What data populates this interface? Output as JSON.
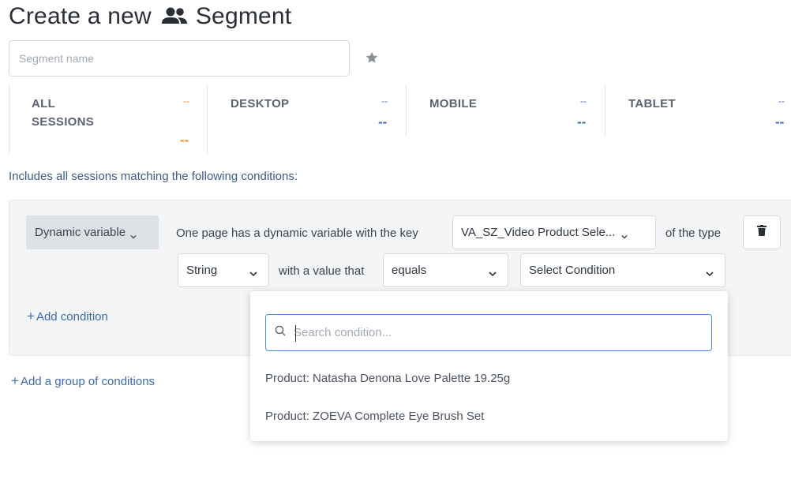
{
  "header": {
    "title_part1": "Create a new",
    "title_part2": "Segment",
    "icon": "people-icon"
  },
  "segment_name": {
    "placeholder": "Segment name",
    "value": ""
  },
  "stats": [
    {
      "label": "ALL",
      "label2": "SESSIONS",
      "small": "--",
      "big": "--",
      "color": "#f08a24"
    },
    {
      "label": "DESKTOP",
      "label2": "",
      "small": "--",
      "big": "--",
      "color": "#3c6aa8"
    },
    {
      "label": "MOBILE",
      "label2": "",
      "small": "--",
      "big": "--",
      "color": "#3c6aa8"
    },
    {
      "label": "TABLET",
      "label2": "",
      "small": "--",
      "big": "--",
      "color": "#3c6aa8"
    }
  ],
  "includes_text": "Includes all sessions matching the following conditions:",
  "condition": {
    "type_button": "Dynamic variable",
    "text1": "One page has a dynamic variable with the key",
    "key_select": "VA_SZ_Video Product Sele...",
    "text2": "of the type",
    "data_type": "String",
    "text3": "with a value that",
    "operator": "equals",
    "value_select": "Select Condition"
  },
  "add_condition": "Add condition",
  "add_group": "Add a group of conditions",
  "dropdown": {
    "search_placeholder": "Search condition...",
    "options": [
      "Product: Natasha Denona Love Palette 19.25g",
      "Product: ZOEVA Complete Eye Brush Set"
    ]
  },
  "colors": {
    "accent_blue": "#3c6aa8",
    "accent_orange": "#f08a24",
    "focus_border": "#4a8fd6"
  }
}
